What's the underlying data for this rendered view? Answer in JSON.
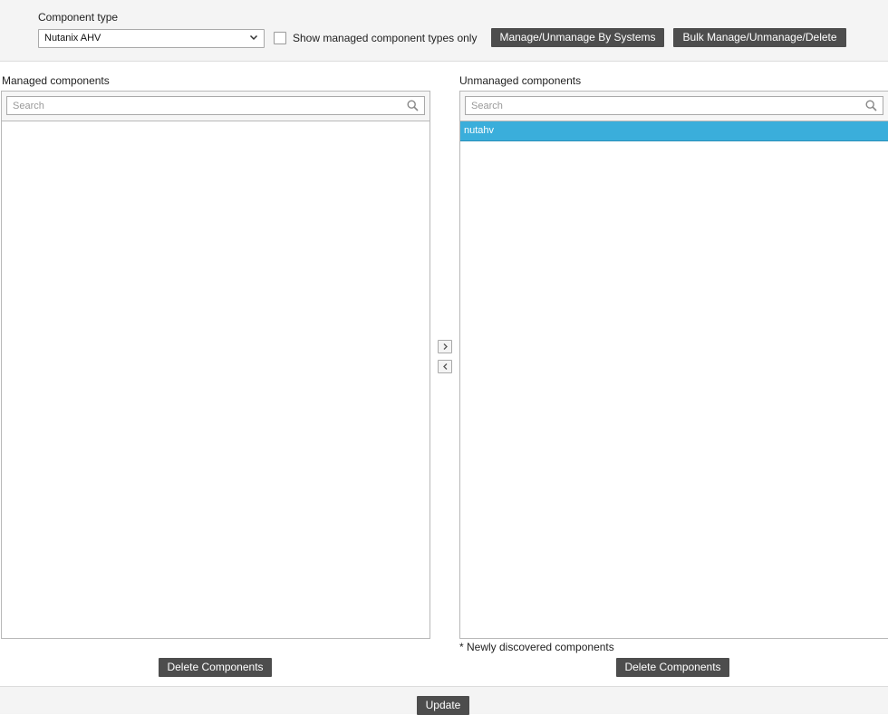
{
  "filter": {
    "component_type_label": "Component type",
    "component_type_value": "Nutanix AHV",
    "show_managed_label": "Show managed component types only",
    "manage_by_systems_label": "Manage/Unmanage By Systems",
    "bulk_label": "Bulk Manage/Unmanage/Delete"
  },
  "managed": {
    "title": "Managed components",
    "search_placeholder": "Search",
    "items": [],
    "delete_label": "Delete Components"
  },
  "unmanaged": {
    "title": "Unmanaged components",
    "search_placeholder": "Search",
    "items": [
      {
        "label": "nutahv",
        "selected": true
      }
    ],
    "footnote": "* Newly discovered components",
    "delete_label": "Delete Components"
  },
  "actions": {
    "update_label": "Update"
  },
  "colors": {
    "selected_row": "#3aaedb",
    "button_bg": "#4d4d4d"
  },
  "icons": {
    "select_chevron": "chevron-down-icon",
    "search": "search-icon",
    "move_right": "chevron-right-icon",
    "move_left": "chevron-left-icon"
  }
}
